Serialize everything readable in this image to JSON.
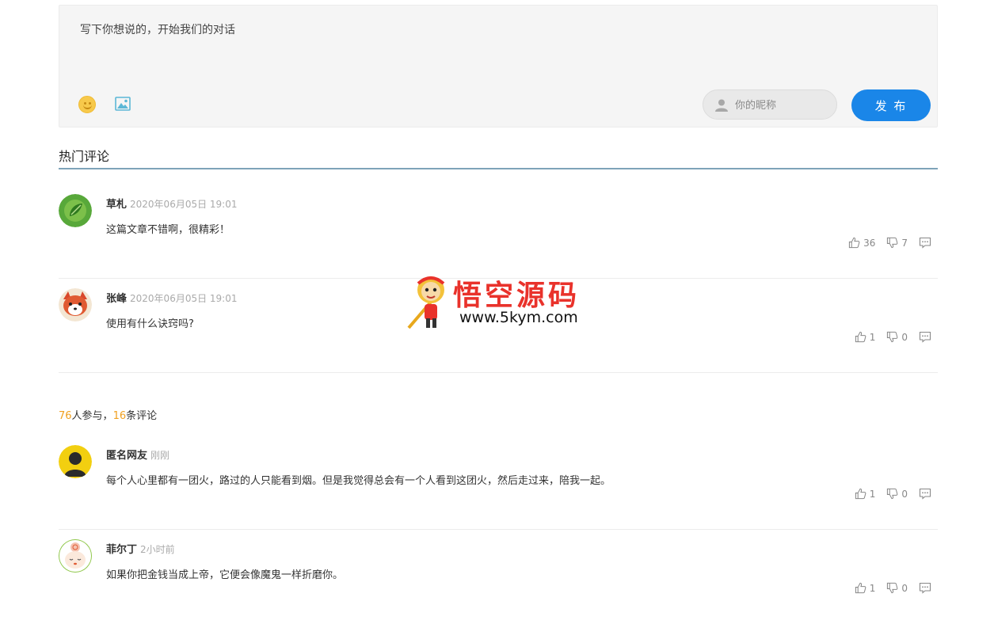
{
  "editor": {
    "placeholder": "写下你想说的，开始我们的对话",
    "nickname_placeholder": "你的昵称",
    "publish_label": "发 布"
  },
  "hot_title": "热门评论",
  "hot_comments": [
    {
      "author": "草札",
      "time": "2020年06月05日 19:01",
      "text": "这篇文章不错啊，很精彩！",
      "likes": "36",
      "dislikes": "7"
    },
    {
      "author": "张峰",
      "time": "2020年06月05日 19:01",
      "text": "使用有什么诀窍吗?",
      "likes": "1",
      "dislikes": "0"
    }
  ],
  "stats": {
    "participants": "76",
    "participants_label": "人参与，",
    "comments": "16",
    "comments_label": "条评论"
  },
  "comments": [
    {
      "author": "匿名网友",
      "time": "刚刚",
      "text": "每个人心里都有一团火，路过的人只能看到烟。但是我觉得总会有一个人看到这团火，然后走过来，陪我一起。",
      "likes": "1",
      "dislikes": "0"
    },
    {
      "author": "菲尔丁",
      "time": "2小时前",
      "text": "如果你把金钱当成上帝，它便会像魔鬼一样折磨你。",
      "likes": "1",
      "dislikes": "0"
    }
  ],
  "watermark": {
    "title": "悟空源码",
    "url": "www.5kym.com"
  },
  "colors": {
    "accent": "#1a86e8",
    "highlight": "#f0a020",
    "watermark": "#e9322b"
  }
}
